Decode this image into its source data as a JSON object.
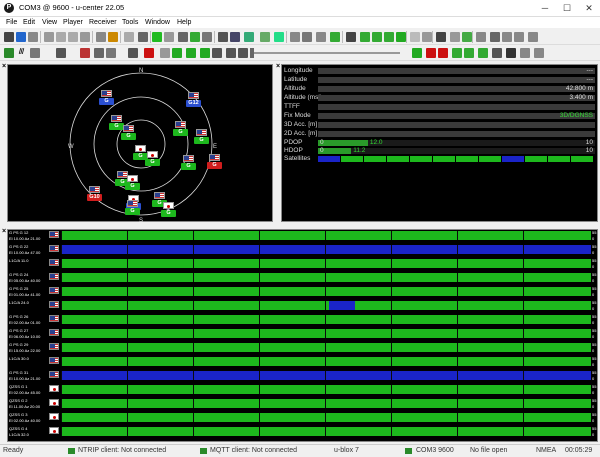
{
  "window": {
    "title": "COM3 @ 9600 - u-center 22.05",
    "app_icon": "P"
  },
  "menu": [
    "File",
    "Edit",
    "View",
    "Player",
    "Receiver",
    "Tools",
    "Window",
    "Help"
  ],
  "toolbar": {
    "baud_label": "Ⅲ"
  },
  "sky": {
    "compass_n": "N",
    "compass_s": "S",
    "compass_w": "W",
    "compass_e": "E",
    "sats": [
      {
        "label": "G",
        "flag": "us",
        "color": "#2a4fd0",
        "fx": "us"
      },
      {
        "label": "G12",
        "flag": "us",
        "color": "#2a4fd0"
      },
      {
        "label": "G",
        "flag": "us",
        "color": "#1db81d"
      },
      {
        "label": "G",
        "flag": "us",
        "color": "#1db81d"
      },
      {
        "label": "G",
        "flag": "us",
        "color": "#1db81d"
      },
      {
        "label": "G",
        "flag": "us",
        "color": "#1db81d"
      },
      {
        "label": "G",
        "flag": "jp",
        "color": "#1db81d"
      },
      {
        "label": "G",
        "flag": "jp",
        "color": "#1db81d"
      },
      {
        "label": "G",
        "flag": "us",
        "color": "#1db81d"
      },
      {
        "label": "G",
        "flag": "us",
        "color": "#d01d1d"
      },
      {
        "label": "G",
        "flag": "us",
        "color": "#1db81d"
      },
      {
        "label": "G",
        "flag": "jp",
        "color": "#1db81d"
      },
      {
        "label": "G10",
        "flag": "us",
        "color": "#d01d1d"
      },
      {
        "label": "G",
        "flag": "us",
        "color": "#1db81d"
      },
      {
        "label": "G",
        "flag": "jp",
        "color": "#2a4fd0"
      },
      {
        "label": "G",
        "flag": "us",
        "color": "#1db81d"
      },
      {
        "label": "G",
        "flag": "jp",
        "color": "#1db81d"
      }
    ]
  },
  "info": {
    "rows": [
      {
        "label": "Longitude",
        "value": "---"
      },
      {
        "label": "Latitude",
        "value": "---"
      },
      {
        "label": "Altitude",
        "value": "42.800 m"
      },
      {
        "label": "Altitude (msl)",
        "value": "3.400 m"
      },
      {
        "label": "TTFF",
        "value": ""
      },
      {
        "label": "Fix Mode",
        "value": "3D/DGNSS"
      },
      {
        "label": "3D Acc. [m]",
        "value": ""
      },
      {
        "label": "2D Acc. [m]",
        "value": ""
      }
    ],
    "pdop": {
      "label": "PDOP",
      "min": "0",
      "max": "10",
      "value_text": "12.0",
      "fill": 0.18
    },
    "hdop": {
      "label": "HDOP",
      "min": "0",
      "max": "10",
      "value_text": "11.2",
      "fill": 0.12
    },
    "satellites_label": "Satellites"
  },
  "signal_rows": [
    {
      "l1": "G PS G 12",
      "l2": "El 10.00 Az 21.00",
      "flag": "us",
      "color": "#1db81d",
      "cn": "55",
      "cn2": "0"
    },
    {
      "l1": "G PS G 22",
      "l2": "El 10.00 Az 47.00",
      "flag": "us",
      "color": "#1a24c8",
      "cn": "55",
      "cn2": "0"
    },
    {
      "l1": "L1C/A 11.0",
      "l2": "",
      "flag": "us",
      "color": "#1db81d",
      "cn": "55",
      "cn2": "0"
    },
    {
      "l1": "G PS G 24",
      "l2": "El 05.00 Az 40.00",
      "flag": "us",
      "color": "#1db81d",
      "cn": "55",
      "cn2": "0"
    },
    {
      "l1": "G PS G 25",
      "l2": "El 01.00 Az 41.00",
      "flag": "us",
      "color": "#1db81d",
      "cn": "55",
      "cn2": "0"
    },
    {
      "l1": "L1C/A 24.0",
      "l2": "",
      "flag": "us",
      "color": "#1db81d",
      "cn": "55",
      "cn2": "0"
    },
    {
      "l1": "G PS G 26",
      "l2": "El 02.00 Az 01.00",
      "flag": "us",
      "color": "#1db81d",
      "cn": "55",
      "cn2": "0"
    },
    {
      "l1": "G PS G 27",
      "l2": "El 06.00 Az 10.00",
      "flag": "us",
      "color": "#1db81d",
      "cn": "55",
      "cn2": "0"
    },
    {
      "l1": "G PS G 29",
      "l2": "El 15.00 Az 22.00",
      "flag": "us",
      "color": "#1db81d",
      "cn": "55",
      "cn2": "0"
    },
    {
      "l1": "L1C/A 30.0",
      "l2": "",
      "flag": "us",
      "color": "#1db81d",
      "cn": "55",
      "cn2": "0"
    },
    {
      "l1": "G PS G 31",
      "l2": "El 10.00 Az 21.00",
      "flag": "us",
      "color": "#1a24c8",
      "cn": "55",
      "cn2": "0"
    },
    {
      "l1": "QZSS G 1",
      "l2": "El 02.00 Az 45.00",
      "flag": "jp",
      "color": "#1db81d",
      "cn": "55",
      "cn2": "0"
    },
    {
      "l1": "QZSS G 2",
      "l2": "El 11.00 Az 20.00",
      "flag": "jp",
      "color": "#1db81d",
      "cn": "55",
      "cn2": "0"
    },
    {
      "l1": "QZSS G 3",
      "l2": "El 02.00 Az 40.00",
      "flag": "jp",
      "color": "#1db81d",
      "cn": "55",
      "cn2": "0"
    },
    {
      "l1": "QZSS G 4",
      "l2": "L1C/A 32.0",
      "flag": "jp",
      "color": "#1db81d",
      "cn": "55",
      "cn2": "0"
    }
  ],
  "status": {
    "ready": "Ready",
    "ntrip": "NTRIP client: Not connected",
    "mqtt": "MQTT client: Not connected",
    "device": "u-blox 7",
    "port": "COM3 9600",
    "file": "No file open",
    "protocol": "NMEA",
    "time": "00:05:29"
  }
}
